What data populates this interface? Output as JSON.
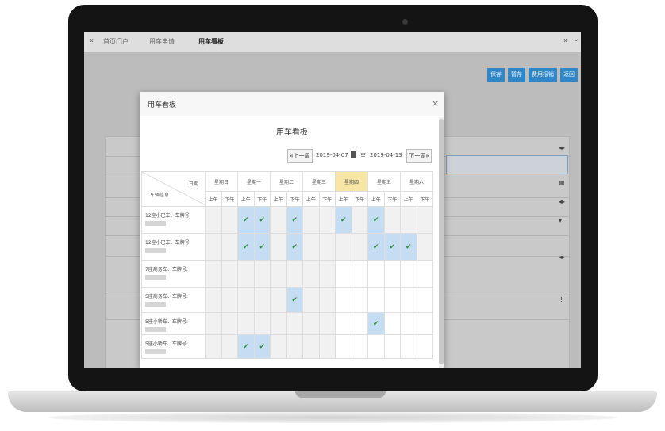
{
  "app": {
    "tabs": [
      "首页门户",
      "用车申请",
      "用车看板"
    ],
    "left_glyph": "«",
    "right_glyph": "»",
    "caret_glyph": "⌄",
    "top_buttons": [
      "保存",
      "暂存",
      "费用报销",
      "返回"
    ]
  },
  "modal": {
    "title": "用车看板",
    "close": "×",
    "board_title": "用车看板",
    "prev_label": "«上一周",
    "next_label": "下一周»",
    "date_from": "2019-04-07",
    "range_sep": "至",
    "date_to": "2019-04-13",
    "corner_date": "日期",
    "corner_vehicle": "车辆信息",
    "am": "上午",
    "pm": "下午",
    "check": "✔",
    "days": [
      {
        "label": "星期日",
        "today": false
      },
      {
        "label": "星期一",
        "today": false
      },
      {
        "label": "星期二",
        "today": false
      },
      {
        "label": "星期三",
        "today": false
      },
      {
        "label": "星期四",
        "today": true
      },
      {
        "label": "星期五",
        "today": false
      },
      {
        "label": "星期六",
        "today": false
      }
    ],
    "vehicles": [
      {
        "name": "12座小巴车、车牌号:",
        "height": 34,
        "slots": [
          0,
          0,
          1,
          1,
          0,
          1,
          0,
          0,
          1,
          0,
          1,
          0,
          0,
          0
        ]
      },
      {
        "name": "12座小巴车、车牌号:",
        "height": 34,
        "slots": [
          0,
          0,
          1,
          1,
          0,
          1,
          0,
          0,
          0,
          0,
          1,
          1,
          1,
          0
        ]
      },
      {
        "name": "7座商务车、车牌号:",
        "height": 34,
        "slots": [
          0,
          0,
          0,
          0,
          0,
          0,
          0,
          0,
          0,
          0,
          0,
          0,
          0,
          0
        ]
      },
      {
        "name": "5座商务车、车牌号:",
        "height": 32,
        "slots": [
          0,
          0,
          0,
          0,
          0,
          1,
          0,
          0,
          0,
          0,
          0,
          0,
          0,
          0
        ]
      },
      {
        "name": "5座小轿车、车牌号:",
        "height": 28,
        "slots": [
          0,
          0,
          0,
          0,
          0,
          0,
          0,
          0,
          0,
          0,
          1,
          0,
          0,
          0
        ]
      },
      {
        "name": "5座小轿车、车牌号:",
        "height": 30,
        "slots": [
          0,
          0,
          1,
          1,
          0,
          0,
          0,
          0,
          0,
          0,
          0,
          0,
          0,
          0
        ]
      }
    ]
  }
}
